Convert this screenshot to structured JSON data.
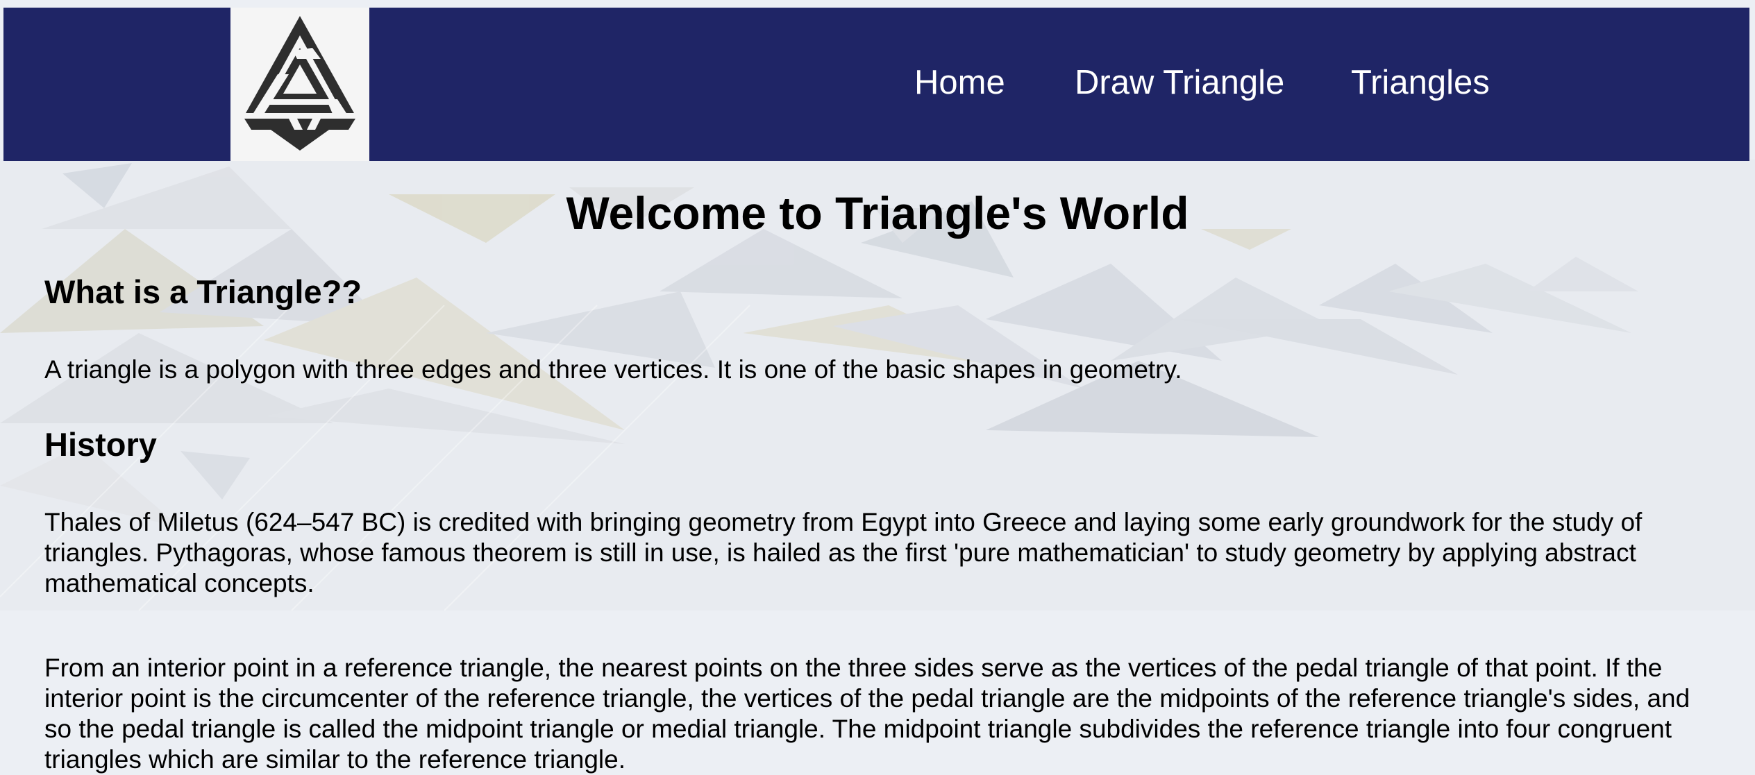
{
  "logo": {
    "icon": "triangle-knot-logo-icon"
  },
  "nav": {
    "items": [
      {
        "label": "Home"
      },
      {
        "label": "Draw Triangle"
      },
      {
        "label": "Triangles"
      }
    ]
  },
  "page": {
    "title": "Welcome to Triangle's World",
    "sections": [
      {
        "heading": "What is a Triangle??",
        "paragraphs": [
          "A triangle is a polygon with three edges and three vertices. It is one of the basic shapes in geometry."
        ]
      },
      {
        "heading": "History",
        "paragraphs": [
          "Thales of Miletus (624–547 BC) is credited with bringing geometry from Egypt into Greece and laying some early groundwork for the study of triangles. Pythagoras, whose famous theorem is still in use, is hailed as the first 'pure mathematician' to study geometry by applying abstract mathematical concepts.",
          "From an interior point in a reference triangle, the nearest points on the three sides serve as the vertices of the pedal triangle of that point. If the interior point is the circumcenter of the reference triangle, the vertices of the pedal triangle are the midpoints of the reference triangle's sides, and so the pedal triangle is called the midpoint triangle or medial triangle. The midpoint triangle subdivides the reference triangle into four congruent triangles which are similar to the reference triangle."
        ]
      }
    ]
  },
  "colors": {
    "navbar": "#1f2566",
    "nav_text": "#ffffff",
    "page_bg": "#eceff4",
    "logo_bg": "#f5f5f5",
    "logo_fg": "#2e2e2e"
  }
}
